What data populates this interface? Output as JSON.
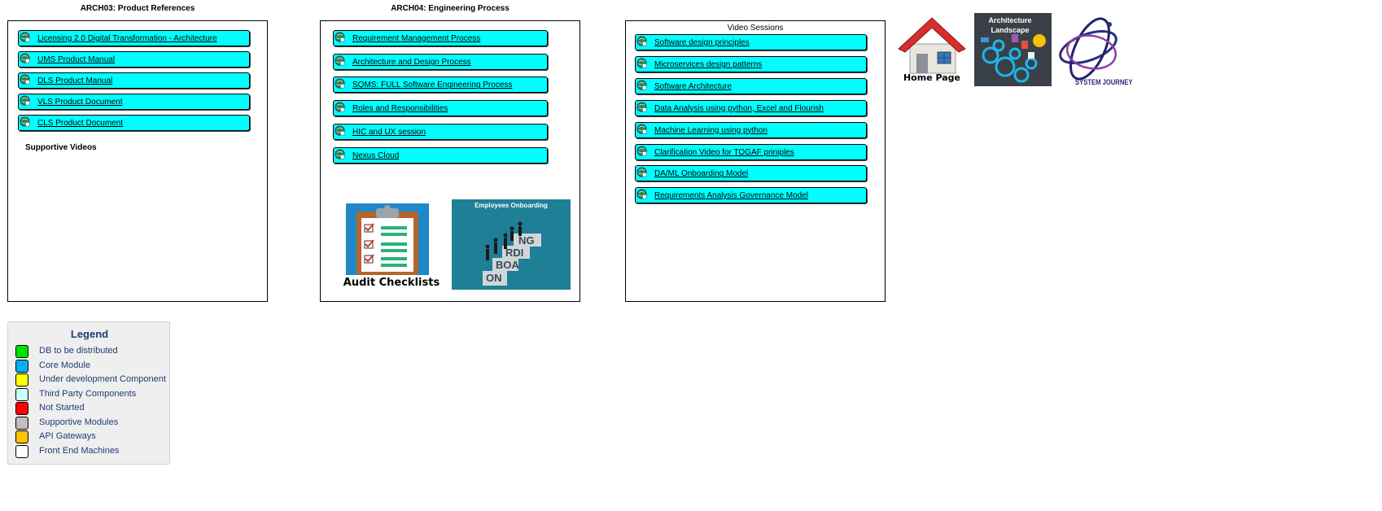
{
  "arch03": {
    "title": "ARCH03: Product References",
    "links": [
      "Licensing 2.0 Digital Transformation - Architecture",
      "UMS Product Manual",
      "DLS Product Manual",
      "VLS Product Document",
      "CLS Product Document"
    ],
    "supportive_label": "Supportive Videos"
  },
  "arch04": {
    "title": "ARCH04: Engineering Process",
    "links": [
      "Requirement Management Process",
      "Architecture and Design Process",
      "SQMS: FULL Software Engineering Process",
      "Roles and Responsibilities",
      "HIC and UX session",
      "Nexus Cloud"
    ],
    "audit_label": "Audit Checklists",
    "onboarding_title": "Employees Onboarding",
    "onboarding_steps": [
      "ON",
      "BOA",
      "RDI",
      "NG"
    ]
  },
  "video": {
    "title": "Video Sessions",
    "links": [
      "Software design principles",
      "Microservices design patterns",
      "Software Architecture",
      "Data Analysis using python, Excel and Flourish",
      "Machine Learning using python",
      "Clarification Video for TOGAF priniples",
      "DA/ML Onboarding Model",
      "Requirements Analysis Governance Model"
    ]
  },
  "nav": {
    "home_label": "Home Page",
    "landscape_label": "Architecture Landscape",
    "journey_label": "SYSTEM JOURNEY"
  },
  "legend": {
    "title": "Legend",
    "items": [
      {
        "label": "DB to be distributed",
        "color": "#00e000"
      },
      {
        "label": "Core Module",
        "color": "#00b0f0"
      },
      {
        "label": "Under development Component",
        "color": "#ffff00"
      },
      {
        "label": "Third Party Components",
        "color": "#ccffff"
      },
      {
        "label": "Not Started",
        "color": "#ff0000"
      },
      {
        "label": "Supportive Modules",
        "color": "#bfbfbf"
      },
      {
        "label": "API Gateways",
        "color": "#ffc000"
      },
      {
        "label": "Front End Machines",
        "color": "#ffffff"
      }
    ]
  }
}
